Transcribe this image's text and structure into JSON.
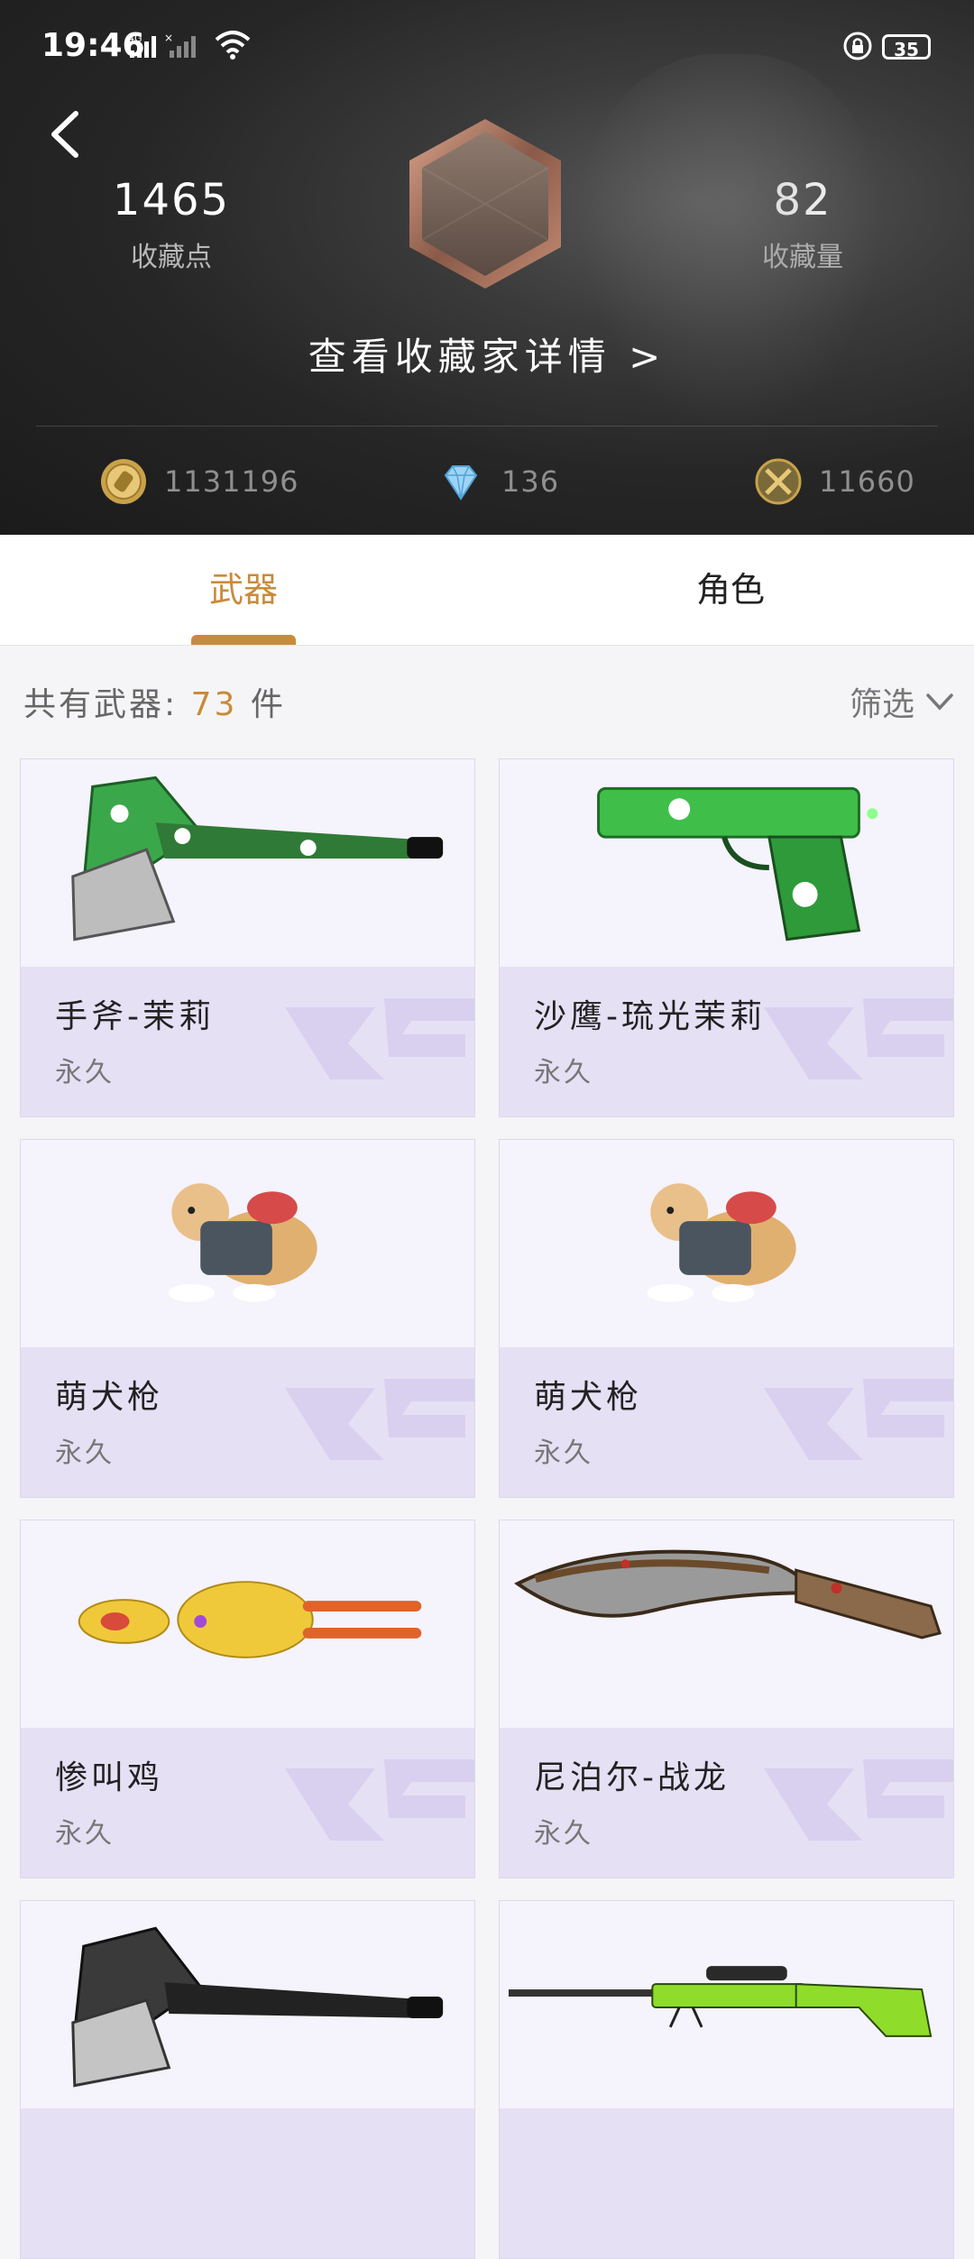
{
  "status_bar": {
    "time": "19:46",
    "network": "4G",
    "battery": "35"
  },
  "header": {
    "left_stat": {
      "value": "1465",
      "label": "收藏点"
    },
    "right_stat": {
      "value": "82",
      "label": "收藏量"
    },
    "details_link": "查看收藏家详情 >",
    "currencies": [
      {
        "icon": "gold-coin-icon",
        "value": "1131196"
      },
      {
        "icon": "diamond-icon",
        "value": "136"
      },
      {
        "icon": "crossed-swords-icon",
        "value": "11660"
      }
    ]
  },
  "tabs": [
    {
      "label": "武器",
      "active": true
    },
    {
      "label": "角色",
      "active": false
    }
  ],
  "count_bar": {
    "prefix": "共有武器:",
    "count": "73",
    "suffix": "件",
    "filter_label": "筛选"
  },
  "items": [
    {
      "name": "手斧-茉莉",
      "duration": "永久",
      "image": "axe-jasmine"
    },
    {
      "name": "沙鹰-琉光茉莉",
      "duration": "永久",
      "image": "deagle-jasmine"
    },
    {
      "name": "萌犬枪",
      "duration": "永久",
      "image": "dog"
    },
    {
      "name": "萌犬枪",
      "duration": "永久",
      "image": "dog"
    },
    {
      "name": "惨叫鸡",
      "duration": "永久",
      "image": "rubber-chicken"
    },
    {
      "name": "尼泊尔-战龙",
      "duration": "永久",
      "image": "kukri"
    },
    {
      "name": "",
      "duration": "",
      "image": "axe-black"
    },
    {
      "name": "",
      "duration": "",
      "image": "sniper-green"
    }
  ],
  "colors": {
    "accent": "#c98b3a",
    "card_bottom": "#e6e0f5",
    "card_top": "#f5f3fb"
  }
}
